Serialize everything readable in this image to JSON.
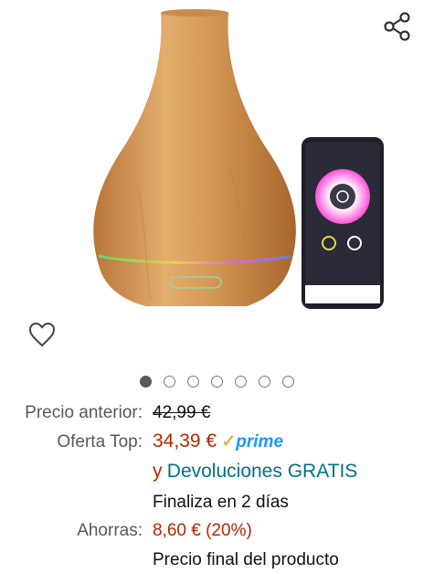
{
  "gallery": {
    "image_count": 7,
    "active_index": 0
  },
  "pricing": {
    "previous_label": "Precio anterior:",
    "previous_value": "42,99 €",
    "deal_label": "Oferta Top:",
    "deal_price": "34,39 €",
    "prime_check": "✓",
    "prime_word": "prime",
    "returns_prefix": "y",
    "returns_text": "Devoluciones GRATIS",
    "ends_text": "Finaliza en 2 días",
    "savings_label": "Ahorras:",
    "savings_value": "8,60 € (20%)",
    "final_note": "Precio final del producto"
  },
  "colors": {
    "price": "#b12704",
    "link": "#007185",
    "prime": "#1a98ff",
    "prime_check": "#f3a847",
    "label": "#565959"
  },
  "icons": {
    "share": "share-icon",
    "wishlist": "heart-icon"
  }
}
